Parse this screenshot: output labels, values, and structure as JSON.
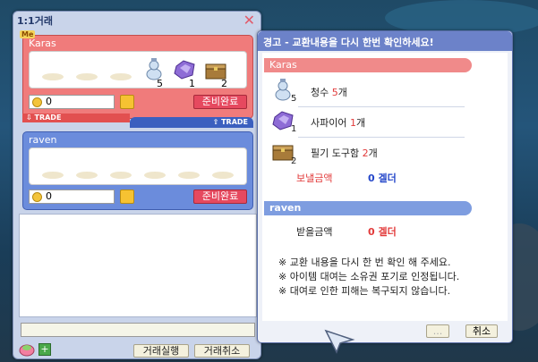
{
  "trade_window": {
    "title": "1:1거래",
    "me": {
      "badge": "Me",
      "name": "Karas",
      "items": [
        {
          "icon": "potion-icon",
          "qty": "5"
        },
        {
          "icon": "sapphire-icon",
          "qty": "1"
        },
        {
          "icon": "writing-kit-icon",
          "qty": "2"
        }
      ],
      "zeny": "0",
      "ready_label": "준비완료"
    },
    "trade_bar_down": "TRADE",
    "trade_bar_up": "TRADE",
    "other": {
      "name": "raven",
      "zeny": "0",
      "ready_label": "준비완료"
    },
    "execute_label": "거래실행",
    "cancel_label": "거래취소"
  },
  "confirm_dialog": {
    "title": "경고 - 교환내용을 다시 한번 확인하세요!",
    "my_name": "Karas",
    "items": [
      {
        "icon": "potion-icon",
        "qty": "5",
        "name": "청수",
        "count": "5",
        "unit": "개"
      },
      {
        "icon": "sapphire-icon",
        "qty": "1",
        "name": "사파이어",
        "count": "1",
        "unit": "개"
      },
      {
        "icon": "writing-kit-icon",
        "qty": "2",
        "name": "필기 도구함",
        "count": "2",
        "unit": "개"
      }
    ],
    "send_label": "보낼금액",
    "send_amount": "0 겔더",
    "other_name": "raven",
    "recv_label": "받을금액",
    "recv_amount": "0 겔더",
    "notices": [
      "※ 교환 내용을 다시 한 번 확인 해 주세요.",
      "※ 아이템 대여는 소유권 포기로 인정됩니다.",
      "※ 대여로 인한 피해는 복구되지 않습니다."
    ],
    "ok_label": "...",
    "cancel_label": "취소"
  }
}
